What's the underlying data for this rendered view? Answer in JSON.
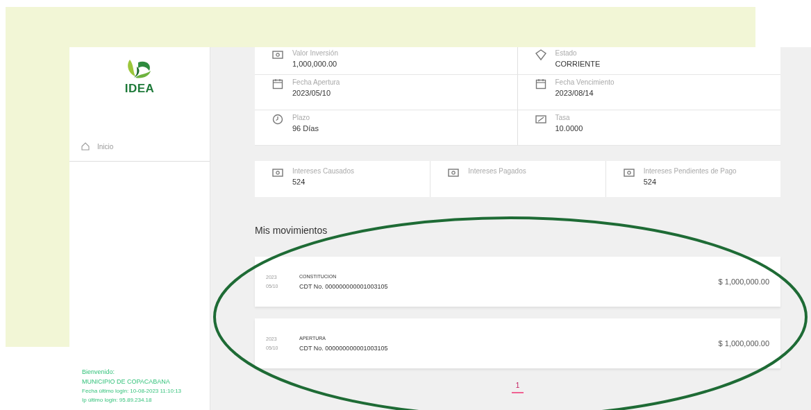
{
  "sidebar": {
    "logo_text": "IDEA",
    "nav": [
      {
        "label": "Inicio"
      }
    ],
    "welcome": "Bienvenido:",
    "user": "MUNICIPIO DE COPACABANA",
    "last_login": "Fecha último login: 10-08-2023 11:10:13",
    "last_ip": "Ip último login: 95.89.234.18"
  },
  "details": [
    {
      "kind": "money",
      "label": "Valor Inversión",
      "value": "1,000,000.00"
    },
    {
      "kind": "badge",
      "label": "Estado",
      "value": "CORRIENTE"
    },
    {
      "kind": "calendar",
      "label": "Fecha Apertura",
      "value": "2023/05/10"
    },
    {
      "kind": "calendar",
      "label": "Fecha Vencimiento",
      "value": "2023/08/14"
    },
    {
      "kind": "clock",
      "label": "Plazo",
      "value": "96 Días"
    },
    {
      "kind": "percent",
      "label": "Tasa",
      "value": "10.0000"
    }
  ],
  "interests": [
    {
      "label": "Intereses Causados",
      "value": "524"
    },
    {
      "label": "Intereses Pagados"
    },
    {
      "label": "Intereses Pendientes de Pago",
      "value": "524"
    }
  ],
  "movements_title": "Mis movimientos",
  "movements": [
    {
      "year": "2023",
      "day": "05/10",
      "type": "CONSTITUCION",
      "reference": "CDT No. 000000000001003105",
      "amount": "$ 1,000,000.00"
    },
    {
      "year": "2023",
      "day": "05/10",
      "type": "APERTURA",
      "reference": "CDT No. 000000000001003105",
      "amount": "$ 1,000,000.00"
    }
  ],
  "pagination": [
    {
      "label": "1",
      "selected": true
    }
  ]
}
